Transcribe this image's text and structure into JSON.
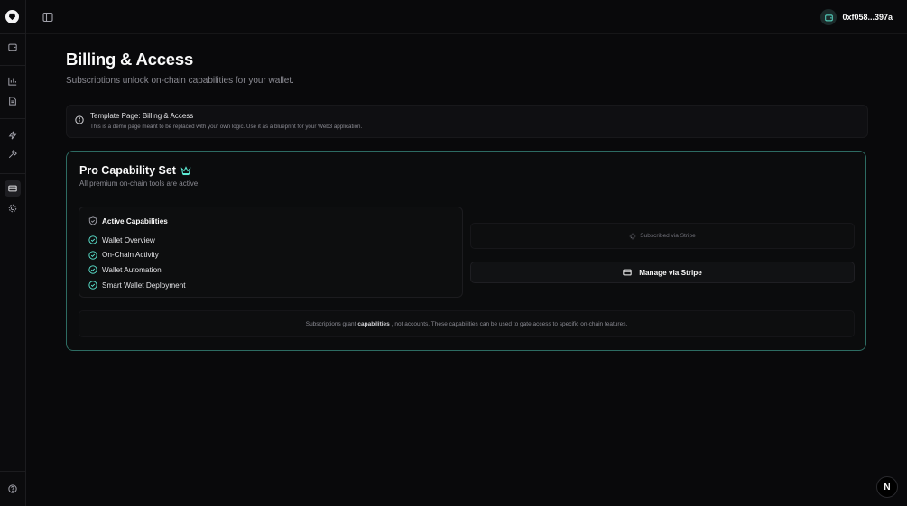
{
  "topbar": {
    "wallet_address": "0xf058...397a"
  },
  "page": {
    "title": "Billing & Access",
    "subtitle": "Subscriptions unlock on-chain capabilities for your wallet."
  },
  "notice": {
    "title": "Template Page: Billing & Access",
    "description": "This is a demo page meant to be replaced with your own logic. Use it as a blueprint for your Web3 application."
  },
  "card": {
    "title": "Pro Capability Set",
    "subtitle": "All premium on-chain tools are active",
    "capabilities_heading": "Active Capabilities",
    "capabilities": [
      "Wallet Overview",
      "On-Chain Activity",
      "Wallet Automation",
      "Smart Wallet Deployment"
    ],
    "subscribed_label": "Subscribed via Stripe",
    "manage_label": "Manage via Stripe",
    "footer_prefix": "Subscriptions grant",
    "footer_bold": "capabilities",
    "footer_suffix": ", not accounts. These capabilities can be used to gate access to specific on-chain features."
  },
  "badge": {
    "label": "N"
  },
  "colors": {
    "accent": "#5eead4",
    "card_border": "#2d6b62",
    "background": "#09090b"
  }
}
